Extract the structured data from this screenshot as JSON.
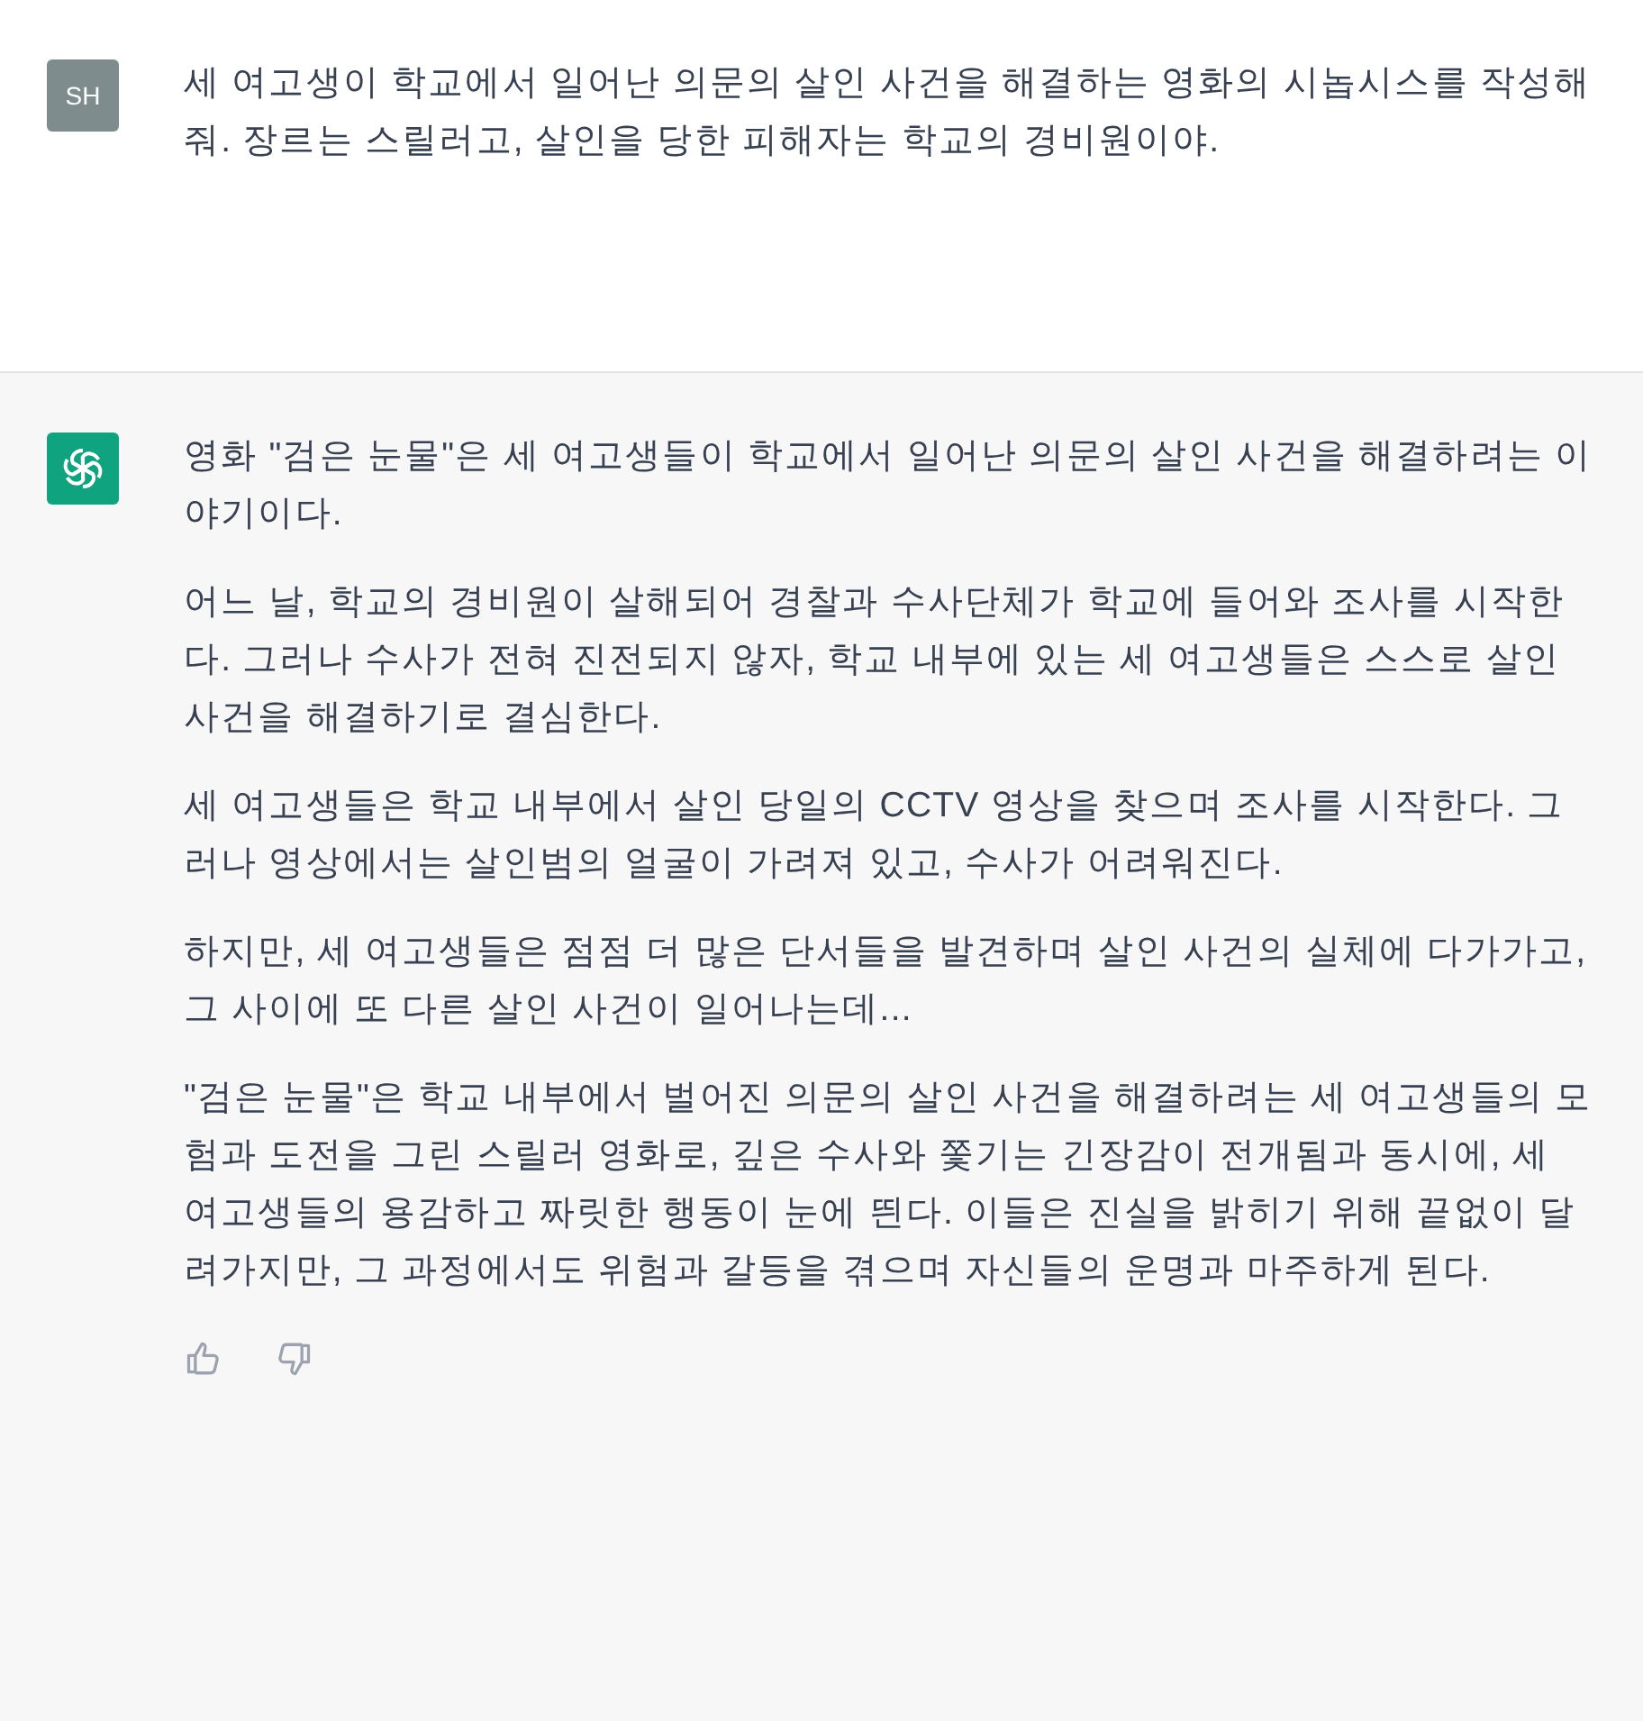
{
  "messages": [
    {
      "kind": "user",
      "avatar": "SH",
      "paragraphs": [
        "세 여고생이 학교에서 일어난 의문의 살인 사건을 해결하는 영화의 시놉시스를 작성해줘. 장르는 스릴러고, 살인을 당한 피해자는 학교의 경비원이야."
      ]
    },
    {
      "kind": "assistant",
      "paragraphs": [
        "영화 \"검은 눈물\"은 세 여고생들이 학교에서 일어난 의문의 살인 사건을 해결하려는 이야기이다.",
        "어느 날, 학교의 경비원이 살해되어 경찰과 수사단체가 학교에 들어와 조사를 시작한다. 그러나 수사가 전혀 진전되지 않자, 학교 내부에 있는 세 여고생들은 스스로 살인 사건을 해결하기로 결심한다.",
        "세 여고생들은 학교 내부에서 살인 당일의 CCTV 영상을 찾으며 조사를 시작한다. 그러나 영상에서는 살인범의 얼굴이 가려져 있고, 수사가 어려워진다.",
        "하지만, 세 여고생들은 점점 더 많은 단서들을 발견하며 살인 사건의 실체에 다가가고, 그 사이에 또 다른 살인 사건이 일어나는데...",
        "\"검은 눈물\"은 학교 내부에서 벌어진 의문의 살인 사건을 해결하려는 세 여고생들의 모험과 도전을 그린 스릴러 영화로, 깊은 수사와 쫓기는 긴장감이 전개됨과 동시에, 세 여고생들의 용감하고 짜릿한 행동이 눈에 띈다. 이들은 진실을 밝히기 위해 끝없이 달려가지만, 그 과정에서도 위험과 갈등을 겪으며 자신들의 운명과 마주하게 된다."
      ]
    }
  ]
}
